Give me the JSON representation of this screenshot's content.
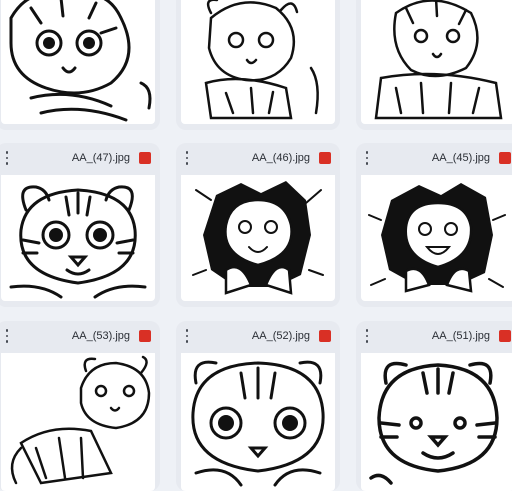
{
  "files": [
    {
      "name": ""
    },
    {
      "name": ""
    },
    {
      "name": ""
    },
    {
      "name": "AA_(47).jpg"
    },
    {
      "name": "AA_(46).jpg"
    },
    {
      "name": "AA_(45).jpg"
    },
    {
      "name": "AA_(53).jpg"
    },
    {
      "name": "AA_(52).jpg"
    },
    {
      "name": "AA_(51).jpg"
    }
  ],
  "icons": {
    "menu": "more-vert-icon",
    "file_type": "image-file-icon",
    "file_type_color": "#d93025"
  }
}
